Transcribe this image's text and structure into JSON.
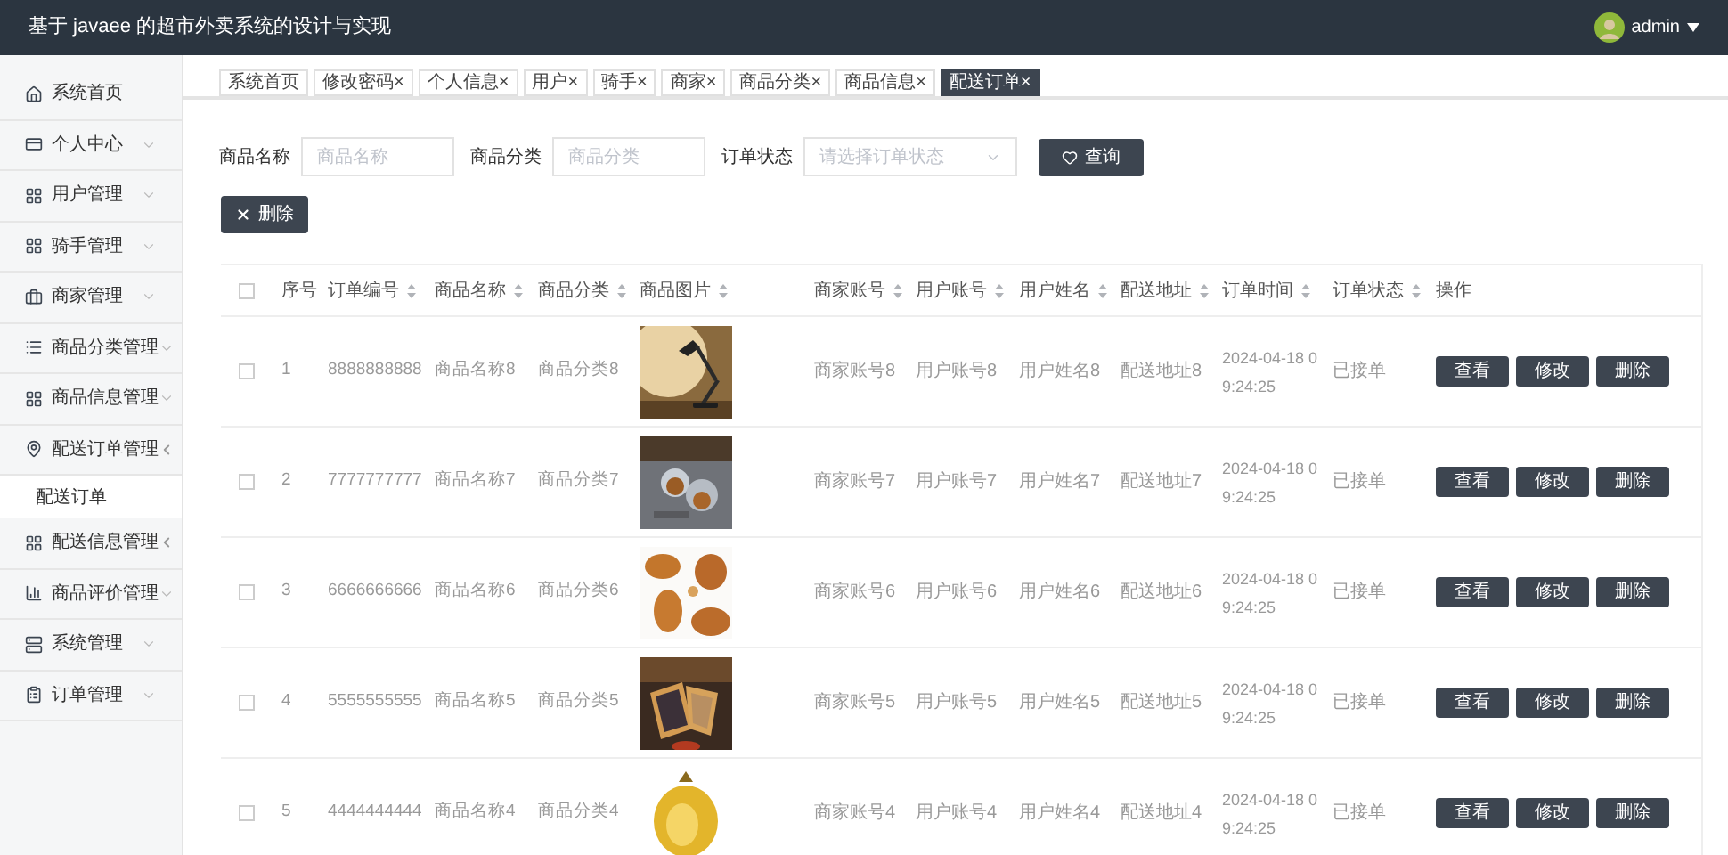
{
  "header": {
    "title": "基于 javaee 的超市外卖系统的设计与实现",
    "user": "admin"
  },
  "sidebar": {
    "items": [
      {
        "label": "系统首页"
      },
      {
        "label": "个人中心",
        "expanded": false
      },
      {
        "label": "用户管理",
        "expanded": false
      },
      {
        "label": "骑手管理",
        "expanded": false
      },
      {
        "label": "商家管理",
        "expanded": false
      },
      {
        "label": "商品分类管理",
        "expanded": false
      },
      {
        "label": "商品信息管理",
        "expanded": false
      },
      {
        "label": "配送订单管理",
        "expanded": true,
        "children": [
          {
            "label": "配送订单",
            "selected": true
          }
        ]
      },
      {
        "label": "配送信息管理",
        "expanded": true
      },
      {
        "label": "商品评价管理",
        "expanded": false
      },
      {
        "label": "系统管理",
        "expanded": false
      },
      {
        "label": "订单管理",
        "expanded": false
      }
    ]
  },
  "tabs": [
    {
      "label": "系统首页",
      "closable": false,
      "selected": false
    },
    {
      "label": "修改密码",
      "closable": true,
      "selected": false
    },
    {
      "label": "个人信息",
      "closable": true,
      "selected": false
    },
    {
      "label": "用户",
      "closable": true,
      "selected": false
    },
    {
      "label": "骑手",
      "closable": true,
      "selected": false
    },
    {
      "label": "商家",
      "closable": true,
      "selected": false
    },
    {
      "label": "商品分类",
      "closable": true,
      "selected": false
    },
    {
      "label": "商品信息",
      "closable": true,
      "selected": false
    },
    {
      "label": "配送订单",
      "closable": true,
      "selected": true
    }
  ],
  "close_mark": "×",
  "filters": [
    {
      "label": "商品名称",
      "placeholder": "商品名称",
      "kind": "text"
    },
    {
      "label": "商品分类",
      "placeholder": "商品分类",
      "kind": "text"
    },
    {
      "label": "订单状态",
      "placeholder": "请选择订单状态",
      "kind": "select"
    }
  ],
  "search_button": "查询",
  "delete_button": "删除",
  "table": {
    "all_checked": false,
    "columns": [
      {
        "label": "序号",
        "sortable": false
      },
      {
        "label": "订单编号",
        "sortable": true
      },
      {
        "label": "商品名称",
        "sortable": true
      },
      {
        "label": "商品分类",
        "sortable": true
      },
      {
        "label": "商品图片",
        "sortable": true
      },
      {
        "label": "商家账号",
        "sortable": true
      },
      {
        "label": "用户账号",
        "sortable": true
      },
      {
        "label": "用户姓名",
        "sortable": true
      },
      {
        "label": "配送地址",
        "sortable": true
      },
      {
        "label": "订单时间",
        "sortable": true
      },
      {
        "label": "订单状态",
        "sortable": true
      },
      {
        "label": "操作",
        "sortable": false
      }
    ],
    "rows": [
      {
        "checked": false,
        "cells": [
          "1",
          "8888888888",
          "商品名称8",
          "商品分类8",
          {
            "kind": "picture"
          },
          "商家账号8",
          "用户账号8",
          "用户姓名8",
          "配送地址8",
          "2024-04-18 09:24:25",
          "已接单"
        ],
        "actions": [
          "查看",
          "修改",
          "删除"
        ]
      },
      {
        "checked": false,
        "cells": [
          "2",
          "7777777777",
          "商品名称7",
          "商品分类7",
          {
            "kind": "picture"
          },
          "商家账号7",
          "用户账号7",
          "用户姓名7",
          "配送地址7",
          "2024-04-18 09:24:25",
          "已接单"
        ],
        "actions": [
          "查看",
          "修改",
          "删除"
        ]
      },
      {
        "checked": false,
        "cells": [
          "3",
          "6666666666",
          "商品名称6",
          "商品分类6",
          {
            "kind": "picture"
          },
          "商家账号6",
          "用户账号6",
          "用户姓名6",
          "配送地址6",
          "2024-04-18 09:24:25",
          "已接单"
        ],
        "actions": [
          "查看",
          "修改",
          "删除"
        ]
      },
      {
        "checked": false,
        "cells": [
          "4",
          "5555555555",
          "商品名称5",
          "商品分类5",
          {
            "kind": "picture"
          },
          "商家账号5",
          "用户账号5",
          "用户姓名5",
          "配送地址5",
          "2024-04-18 09:24:25",
          "已接单"
        ],
        "actions": [
          "查看",
          "修改",
          "删除"
        ]
      },
      {
        "checked": false,
        "cells": [
          "5",
          "4444444444",
          "商品名称4",
          "商品分类4",
          {
            "kind": "picture"
          },
          "商家账号4",
          "用户账号4",
          "用户姓名4",
          "配送地址4",
          "2024-04-18 09:24:25",
          "已接单"
        ],
        "actions": [
          "查看",
          "修改",
          "删除"
        ]
      }
    ]
  }
}
